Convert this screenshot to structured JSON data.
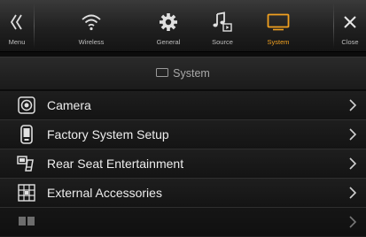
{
  "toolbar": {
    "items": [
      {
        "label": "Menu",
        "icon": "double-chevron-left-icon"
      },
      {
        "label": "Wireless",
        "icon": "wifi-icon"
      },
      {
        "label": "General",
        "icon": "gear-icon"
      },
      {
        "label": "Source",
        "icon": "music-source-icon"
      },
      {
        "label": "System",
        "icon": "monitor-icon",
        "active": true
      },
      {
        "label": "Close",
        "icon": "close-icon"
      }
    ]
  },
  "section": {
    "title": "System",
    "icon": "monitor-icon"
  },
  "list": {
    "items": [
      {
        "label": "Camera",
        "icon": "camera-icon"
      },
      {
        "label": "Factory System Setup",
        "icon": "phone-setup-icon"
      },
      {
        "label": "Rear Seat Entertainment",
        "icon": "rear-seat-icon"
      },
      {
        "label": "External Accessories",
        "icon": "accessories-icon"
      },
      {
        "label": "",
        "icon": "partial-item-icon"
      }
    ]
  },
  "colors": {
    "accent": "#f0a020",
    "background": "#0c0c0c",
    "text": "#ededed"
  }
}
